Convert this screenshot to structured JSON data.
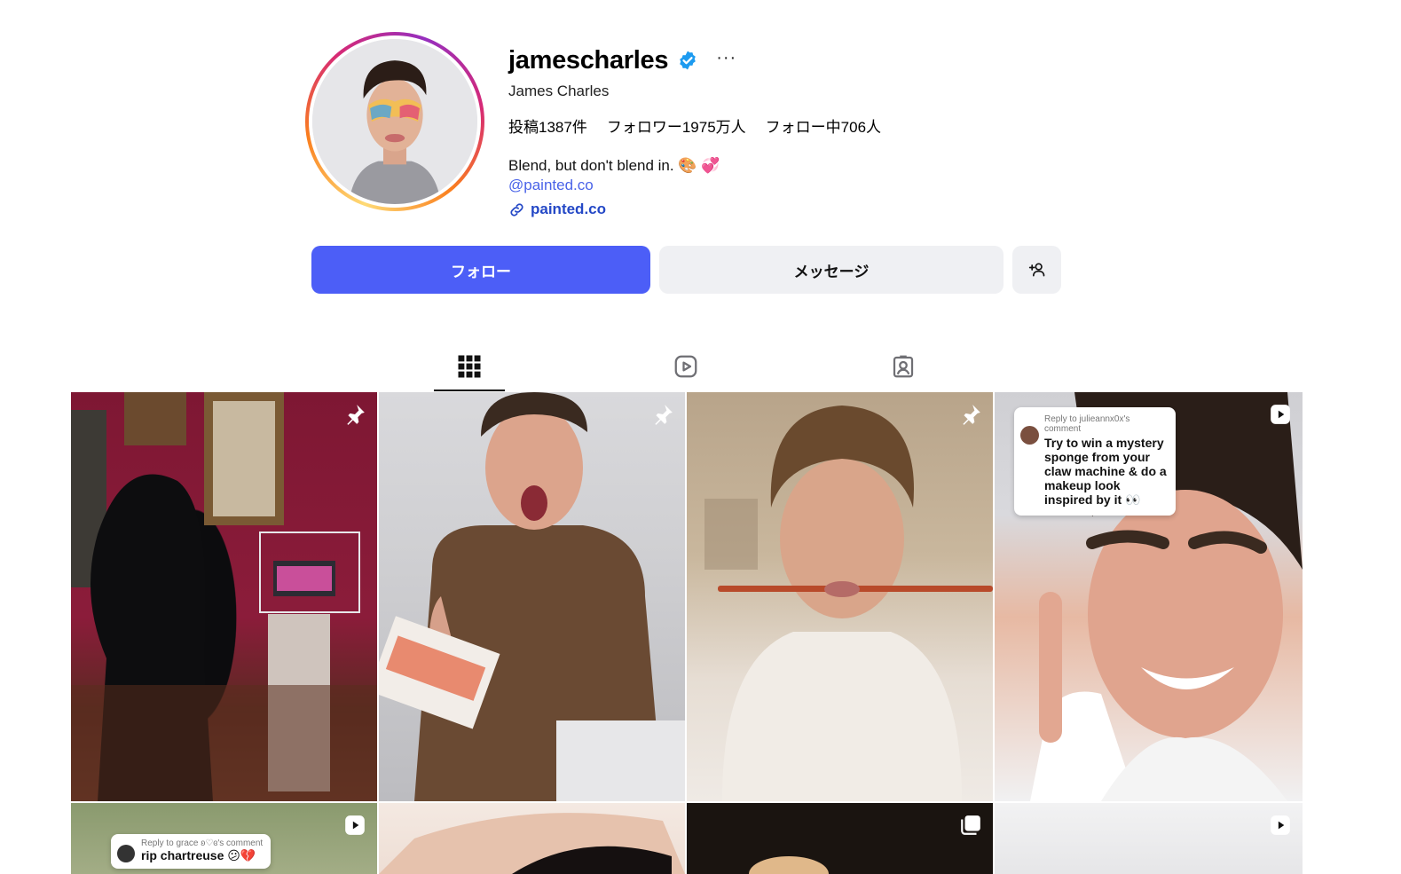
{
  "profile": {
    "username": "jamescharles",
    "full_name": "James Charles",
    "more_label": "···",
    "stats": {
      "posts": "投稿1387件",
      "followers": "フォロワー1975万人",
      "following": "フォロー中706人"
    },
    "bio": "Blend, but don't blend in. 🎨 💞",
    "mention": "@painted.co",
    "link": "painted.co"
  },
  "actions": {
    "follow_label": "フォロー",
    "message_label": "メッセージ"
  },
  "tabs": [
    {
      "name": "posts",
      "icon": "grid-icon",
      "active": true
    },
    {
      "name": "reels",
      "icon": "reels-icon",
      "active": false
    },
    {
      "name": "tagged",
      "icon": "tagged-icon",
      "active": false
    }
  ],
  "posts": [
    {
      "badge": "pin-icon"
    },
    {
      "badge": "pin-icon"
    },
    {
      "badge": "pin-icon"
    },
    {
      "badge": "reel-icon",
      "comment_reply": "Reply to julieannx0x's comment",
      "comment_text": "Try to win a mystery sponge from your claw machine & do a makeup look inspired by it 👀"
    },
    {
      "badge": "reel-icon",
      "comment_reply": "Reply to grace ʚ♡ɞ's comment",
      "comment_text": "rip chartreuse 😕💔"
    },
    {
      "badge": "none"
    },
    {
      "badge": "carousel-icon"
    },
    {
      "badge": "reel-icon"
    }
  ],
  "colors": {
    "accent": "#4c5ef7",
    "link": "#2448c6",
    "mention": "#4a63e8",
    "button_secondary": "#eff0f3",
    "verified": "#1d9bf0"
  }
}
